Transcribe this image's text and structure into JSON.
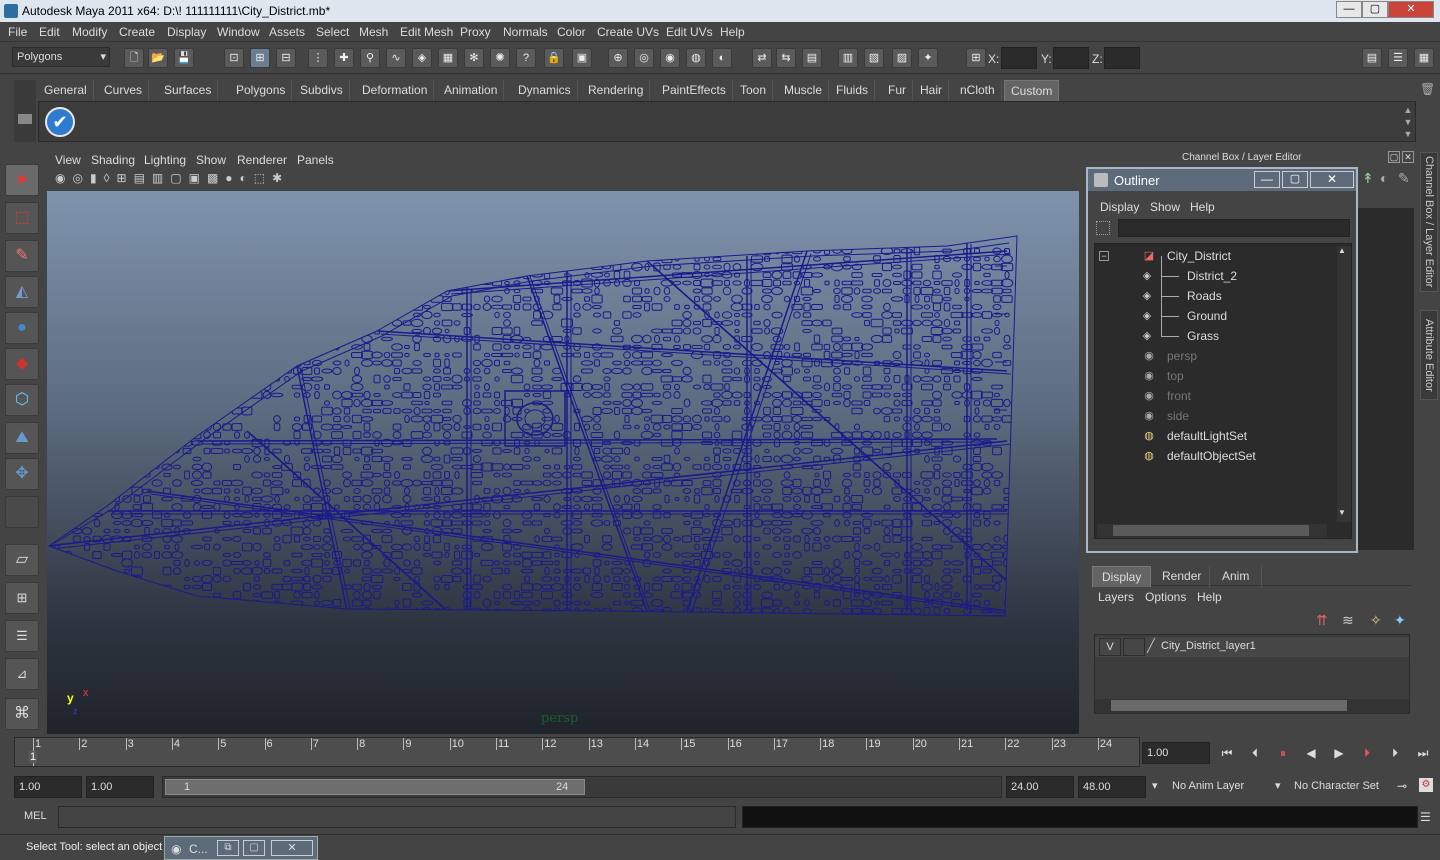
{
  "window": {
    "title": "Autodesk Maya 2011 x64: D:\\! 111111111\\City_District.mb*",
    "min": "—",
    "max": "▢",
    "close": "✕"
  },
  "menu": [
    "File",
    "Edit",
    "Modify",
    "Create",
    "Display",
    "Window",
    "Assets",
    "Select",
    "Mesh",
    "Edit Mesh",
    "Proxy",
    "Normals",
    "Color",
    "Create UVs",
    "Edit UVs",
    "Help"
  ],
  "status": {
    "mode": "Polygons",
    "x_label": "X:",
    "y_label": "Y:",
    "z_label": "Z:"
  },
  "shelf_tabs": [
    "General",
    "Curves",
    "Surfaces",
    "Polygons",
    "Subdivs",
    "Deformation",
    "Animation",
    "Dynamics",
    "Rendering",
    "PaintEffects",
    "Toon",
    "Muscle",
    "Fluids",
    "Fur",
    "Hair",
    "nCloth",
    "Custom"
  ],
  "shelf_active": "Custom",
  "viewport": {
    "menu": [
      "View",
      "Shading",
      "Lighting",
      "Show",
      "Renderer",
      "Panels"
    ],
    "camera_label": "persp",
    "axis_y": "y",
    "axis_x": "x",
    "axis_z": "z"
  },
  "channel_box_title": "Channel Box / Layer Editor",
  "side_tabs": {
    "channel": "Channel Box / Layer Editor",
    "attr": "Attribute Editor"
  },
  "outliner": {
    "title": "Outliner",
    "menu": [
      "Display",
      "Show",
      "Help"
    ],
    "items": [
      {
        "label": "City_District",
        "depth": 0,
        "dim": false,
        "icon": "mesh-group-icon"
      },
      {
        "label": "District_2",
        "depth": 1,
        "dim": false,
        "icon": "mesh-icon"
      },
      {
        "label": "Roads",
        "depth": 1,
        "dim": false,
        "icon": "mesh-icon"
      },
      {
        "label": "Ground",
        "depth": 1,
        "dim": false,
        "icon": "mesh-icon"
      },
      {
        "label": "Grass",
        "depth": 1,
        "dim": false,
        "icon": "mesh-icon"
      },
      {
        "label": "persp",
        "depth": 0,
        "dim": true,
        "icon": "camera-icon"
      },
      {
        "label": "top",
        "depth": 0,
        "dim": true,
        "icon": "camera-icon"
      },
      {
        "label": "front",
        "depth": 0,
        "dim": true,
        "icon": "camera-icon"
      },
      {
        "label": "side",
        "depth": 0,
        "dim": true,
        "icon": "camera-icon"
      },
      {
        "label": "defaultLightSet",
        "depth": 0,
        "dim": false,
        "icon": "set-icon"
      },
      {
        "label": "defaultObjectSet",
        "depth": 0,
        "dim": false,
        "icon": "set-icon"
      }
    ]
  },
  "layer_editor": {
    "tabs": [
      "Display",
      "Render",
      "Anim"
    ],
    "active": "Display",
    "menu": [
      "Layers",
      "Options",
      "Help"
    ],
    "layer": {
      "visible": "V",
      "name": "City_District_layer1"
    }
  },
  "timeline": {
    "ticks": [
      "1",
      "2",
      "3",
      "4",
      "5",
      "6",
      "7",
      "8",
      "9",
      "10",
      "11",
      "12",
      "13",
      "14",
      "15",
      "16",
      "17",
      "18",
      "19",
      "20",
      "21",
      "22",
      "23",
      "24"
    ],
    "current_frame_marker": "1",
    "current_time": "1.00"
  },
  "range": {
    "start": "1.00",
    "playback_start": "1.00",
    "slider_start": "1",
    "slider_end": "24",
    "playback_end": "24.00",
    "end": "48.00",
    "anim_layer": "No Anim Layer",
    "character_set": "No Character Set"
  },
  "command": {
    "lang": "MEL"
  },
  "help": {
    "text": "Select Tool: select an object",
    "task_label": "C..."
  },
  "colors": {
    "wire": "#1a1a8c",
    "bg": "#444444",
    "title_active": "#5c6a7a"
  }
}
